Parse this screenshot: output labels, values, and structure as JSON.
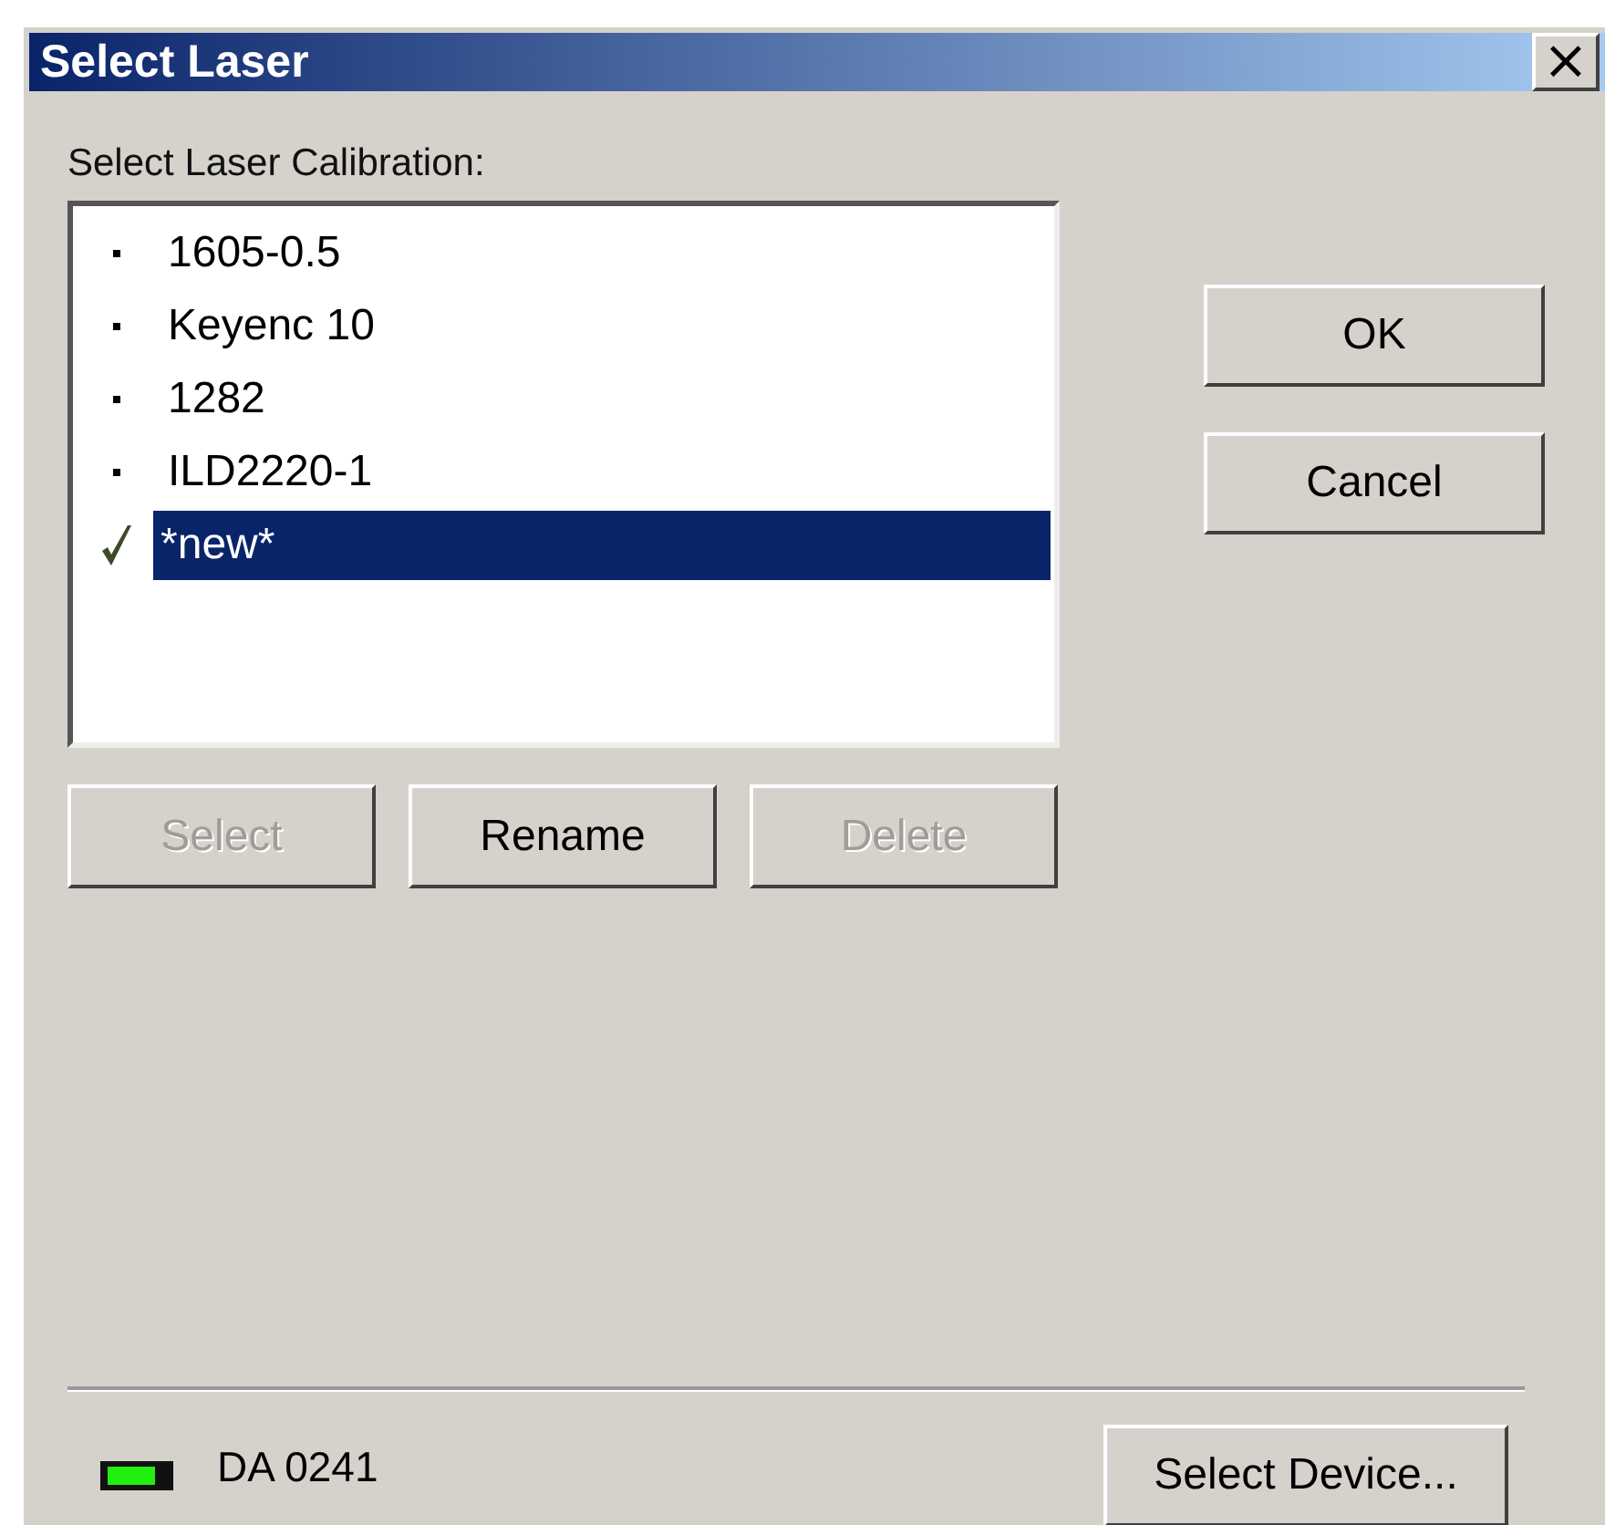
{
  "window": {
    "title": "Select Laser",
    "close": "×"
  },
  "calibration": {
    "label": "Select Laser Calibration:",
    "items": [
      {
        "label": "1605-0.5",
        "checked": false,
        "selected": false
      },
      {
        "label": "Keyenc 10",
        "checked": false,
        "selected": false
      },
      {
        "label": "1282",
        "checked": false,
        "selected": false
      },
      {
        "label": "ILD2220-1",
        "checked": false,
        "selected": false
      },
      {
        "label": "*new*",
        "checked": true,
        "selected": true
      }
    ]
  },
  "list_buttons": [
    {
      "label": "Select",
      "disabled": true
    },
    {
      "label": "Rename",
      "disabled": false
    },
    {
      "label": "Delete",
      "disabled": true
    }
  ],
  "dialog_buttons": [
    "OK",
    "Cancel"
  ],
  "device": {
    "name": "DA 0241",
    "on": true,
    "button": "Select Device..."
  }
}
